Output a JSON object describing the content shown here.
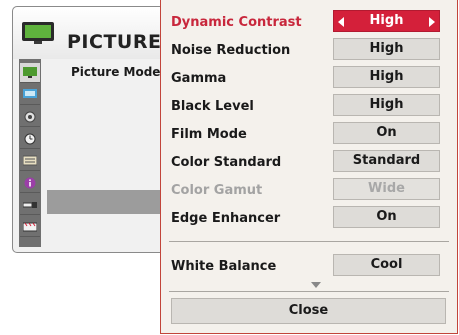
{
  "background_menu": {
    "title": "PICTURE",
    "selected_item": "Picture Mode",
    "sidebar_icons": [
      "picture-icon",
      "screen-icon",
      "audio-icon",
      "time-icon",
      "option-icon",
      "info-icon",
      "input-icon",
      "usb-icon"
    ]
  },
  "dropdown": {
    "rows": [
      {
        "label": "Dynamic Contrast",
        "value": "High"
      },
      {
        "label": "Noise Reduction",
        "value": "High"
      },
      {
        "label": "Gamma",
        "value": "High"
      },
      {
        "label": "Black Level",
        "value": "High"
      },
      {
        "label": "Film Mode",
        "value": "On"
      },
      {
        "label": "Color Standard",
        "value": "Standard"
      },
      {
        "label": "Color Gamut",
        "value": "Wide"
      },
      {
        "label": "Edge Enhancer",
        "value": "On"
      },
      {
        "label": "White Balance",
        "value": "Cool"
      }
    ],
    "close_label": "Close"
  },
  "colors": {
    "accent": "#d4203a",
    "selected_label": "#c8273c",
    "disabled_text": "#a3a3a3"
  }
}
